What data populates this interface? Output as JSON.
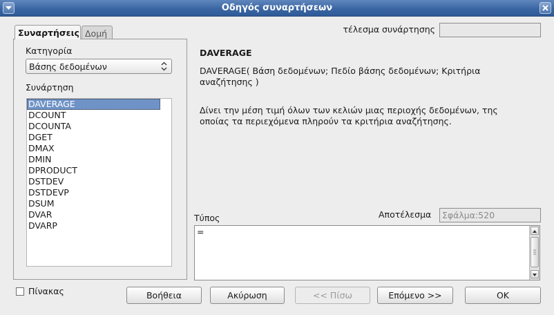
{
  "window": {
    "title": "Οδηγός συναρτήσεων"
  },
  "tabs": [
    {
      "label": "Συναρτήσεις"
    },
    {
      "label": "Δομή"
    }
  ],
  "left": {
    "category_label": "Κατηγορία",
    "category_value": "Βάσης δεδομένων",
    "function_label": "Συνάρτηση",
    "functions": [
      "DAVERAGE",
      "DCOUNT",
      "DCOUNTA",
      "DGET",
      "DMAX",
      "DMIN",
      "DPRODUCT",
      "DSTDEV",
      "DSTDEVP",
      "DSUM",
      "DVAR",
      "DVARP"
    ],
    "selected_index": 0
  },
  "right": {
    "function_result_label": "τέλεσμα συνάρτησης",
    "function_result_value": "",
    "function_name": "DAVERAGE",
    "syntax": "DAVERAGE( Βάση δεδομένων; Πεδίο βάσης δεδομένων; Κριτήρια αναζήτησης )",
    "description": "Δίνει την μέση τιμή όλων των κελιών μιας περιοχής δεδομένων, της οποίας τα περιεχόμενα πληρούν τα κριτήρια αναζήτησης.",
    "formula_label": "Τύπος",
    "result_label": "Αποτέλεσμα",
    "result_value": "Σφάλμα:520",
    "formula_text": "="
  },
  "bottom": {
    "array_label": "Πίνακας",
    "array_checked": false,
    "help_label": "Βοήθεια",
    "cancel_label": "Ακύρωση",
    "back_label": "<< Πίσω",
    "next_label": "Επόμενο >>",
    "ok_label": "OK"
  }
}
